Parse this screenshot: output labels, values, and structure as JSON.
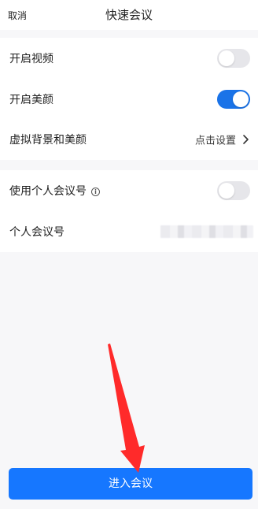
{
  "header": {
    "cancel_label": "取消",
    "title": "快速会议"
  },
  "video_section": {
    "rows": [
      {
        "label": "开启视频",
        "toggle": "off"
      },
      {
        "label": "开启美颜",
        "toggle": "on"
      },
      {
        "label": "虚拟背景和美颜",
        "value": "点击设置"
      }
    ]
  },
  "personal_section": {
    "rows": [
      {
        "label": "使用个人会议号",
        "toggle": "off",
        "info_icon": "info-icon"
      },
      {
        "label": "个人会议号"
      }
    ]
  },
  "footer": {
    "join_label": "进入会议"
  },
  "colors": {
    "accent": "#1677ff",
    "toggle_on": "#1a73e8",
    "toggle_off": "#e6e6ea",
    "annotation_arrow": "#ff2a2a"
  }
}
